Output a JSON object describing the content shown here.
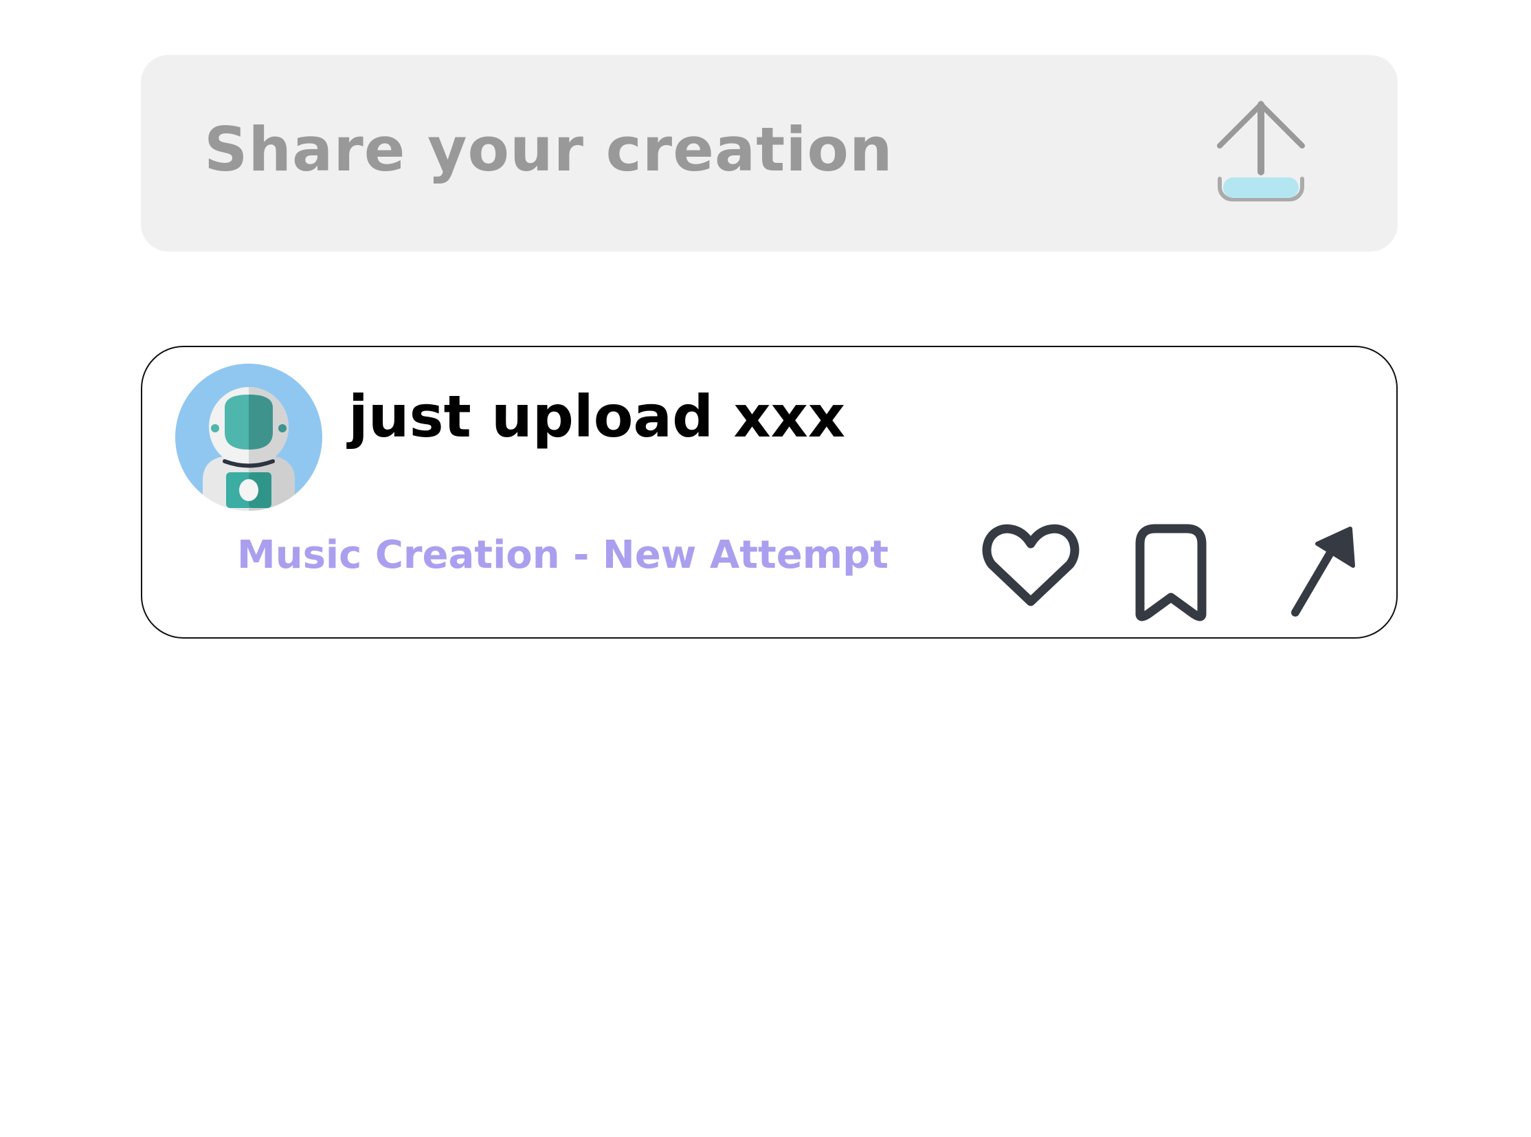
{
  "share_bar": {
    "placeholder": "Share your creation",
    "upload_icon": "upload-tray-icon"
  },
  "post": {
    "avatar_icon": "astronaut-avatar",
    "title": "just upload xxx",
    "subtitle": "Music Creation - New Attempt",
    "actions": {
      "like_icon": "heart-icon",
      "save_icon": "bookmark-icon",
      "share_icon": "arrow-up-right-icon"
    }
  },
  "colors": {
    "share_bar_bg": "#f0f0f0",
    "placeholder_text": "#999999",
    "subtitle_text": "#aa9fef",
    "icon_stroke": "#363a43",
    "upload_tray_fill": "#b4e6f2"
  }
}
